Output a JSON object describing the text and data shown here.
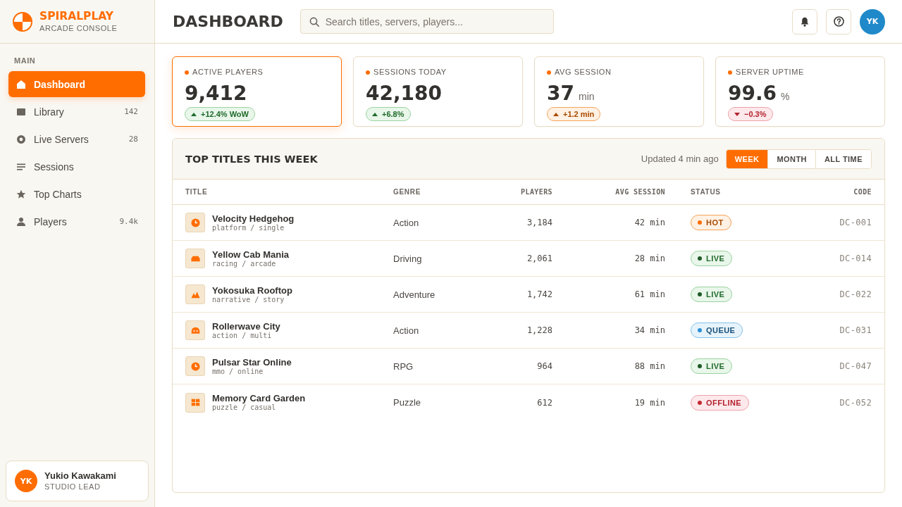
{
  "sidebar": {
    "brand": {
      "name": "SPIRALPLAY",
      "subtitle": "ARCADE CONSOLE"
    },
    "section": "MAIN",
    "items": [
      {
        "kind": "home",
        "label": "Dashboard",
        "selected": true
      },
      {
        "kind": "library",
        "label": "Library",
        "count": "142",
        "selected": false
      },
      {
        "kind": "server",
        "label": "Live Servers",
        "count": "28",
        "selected": false
      },
      {
        "kind": "sessions",
        "label": "Sessions",
        "selected": false
      },
      {
        "kind": "charts",
        "label": "Top Charts",
        "selected": false
      },
      {
        "kind": "players",
        "label": "Players",
        "count": "9.4k",
        "selected": false
      }
    ],
    "user": {
      "initials": "YK",
      "name": "Yukio Kawakami",
      "role": "STUDIO LEAD"
    }
  },
  "header": {
    "title": "DASHBOARD",
    "search": {
      "placeholder": "Search titles, servers, players..."
    },
    "avatar": "YK"
  },
  "kpis": [
    {
      "label": "ACTIVE PLAYERS",
      "value": "9,412",
      "selected": true,
      "delta": {
        "kind": "gain",
        "text": "+12.4% WoW"
      }
    },
    {
      "label": "SESSIONS TODAY",
      "value": "42,180",
      "selected": false,
      "delta": {
        "kind": "gain",
        "text": "+6.8%"
      }
    },
    {
      "label": "AVG SESSION",
      "value": "37",
      "unit": "min",
      "selected": false,
      "delta": {
        "kind": "warn",
        "text": "+1.2 min"
      }
    },
    {
      "label": "SERVER UPTIME",
      "value": "99.6",
      "unit": "%",
      "selected": false,
      "delta": {
        "kind": "loss",
        "text": "−0.3%"
      }
    }
  ],
  "table": {
    "title": "TOP TITLES THIS WEEK",
    "updated": "Updated 4 min ago",
    "tabs": [
      {
        "label": "WEEK",
        "selected": true
      },
      {
        "label": "MONTH",
        "selected": false
      },
      {
        "label": "ALL TIME",
        "selected": false
      }
    ],
    "columns": [
      {
        "label": "TITLE",
        "kind": "text"
      },
      {
        "label": "GENRE",
        "kind": "text"
      },
      {
        "label": "PLAYERS",
        "kind": "number"
      },
      {
        "label": "AVG SESSION",
        "kind": "number"
      },
      {
        "label": "STATUS",
        "kind": "status"
      },
      {
        "label": "CODE",
        "kind": "number"
      }
    ],
    "rows": [
      {
        "kind": "timer",
        "title": "Velocity Hedgehog",
        "tags": "platform / single",
        "genre": "Action",
        "players": "3,184",
        "avg_session": "42 min",
        "status": {
          "label": "HOT",
          "kind": "hot"
        },
        "code": "DC-001"
      },
      {
        "kind": "vehicle",
        "title": "Yellow Cab Mania",
        "tags": "racing / arcade",
        "genre": "Driving",
        "players": "2,061",
        "avg_session": "28 min",
        "status": {
          "label": "LIVE",
          "kind": "live"
        },
        "code": "DC-014"
      },
      {
        "kind": "mountain",
        "title": "Yokosuka Rooftop",
        "tags": "narrative / story",
        "genre": "Adventure",
        "players": "1,742",
        "avg_session": "61 min",
        "status": {
          "label": "LIVE",
          "kind": "live"
        },
        "code": "DC-022"
      },
      {
        "kind": "dome",
        "title": "Rollerwave City",
        "tags": "action / multi",
        "genre": "Action",
        "players": "1,228",
        "avg_session": "34 min",
        "status": {
          "label": "QUEUE",
          "kind": "queue"
        },
        "code": "DC-031"
      },
      {
        "kind": "timer",
        "title": "Pulsar Star Online",
        "tags": "mmo / online",
        "genre": "RPG",
        "players": "964",
        "avg_session": "88 min",
        "status": {
          "label": "LIVE",
          "kind": "live"
        },
        "code": "DC-047"
      },
      {
        "kind": "tiles",
        "title": "Memory Card Garden",
        "tags": "puzzle / casual",
        "genre": "Puzzle",
        "players": "612",
        "avg_session": "19 min",
        "status": {
          "label": "OFFLINE",
          "kind": "offline"
        },
        "code": "DC-052"
      }
    ]
  }
}
